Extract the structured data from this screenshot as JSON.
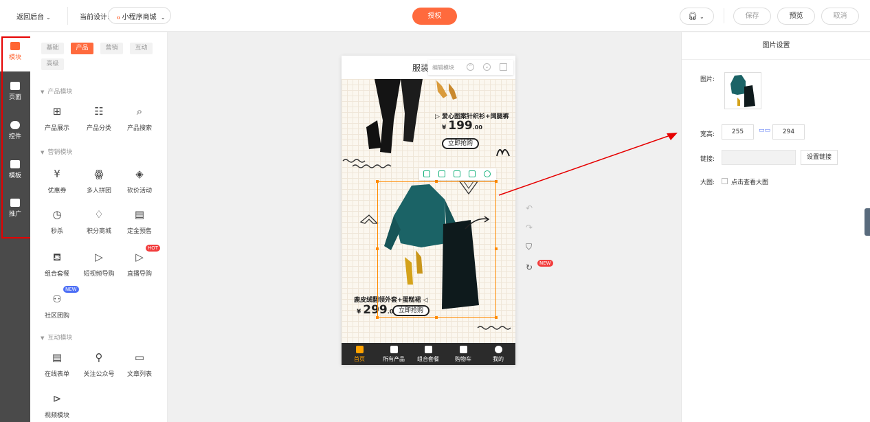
{
  "topbar": {
    "back_label": "返回后台",
    "design_label": "当前设计:",
    "design_select": "小程序商城",
    "auth_label": "授权",
    "save_label": "保存",
    "preview_label": "预览",
    "cancel_label": "取消"
  },
  "rail": {
    "items": [
      {
        "label": "模块",
        "icon": "module-icon"
      },
      {
        "label": "页面",
        "icon": "page-icon"
      },
      {
        "label": "控件",
        "icon": "control-icon"
      },
      {
        "label": "模板",
        "icon": "template-icon"
      },
      {
        "label": "推广",
        "icon": "megaphone-icon"
      }
    ]
  },
  "panel": {
    "tabs": [
      "基础",
      "产品",
      "营销",
      "互动",
      "高级"
    ],
    "active_tab": "产品",
    "sections": [
      {
        "title": "产品模块",
        "items": [
          {
            "label": "产品展示",
            "icon": "grid-icon"
          },
          {
            "label": "产品分类",
            "icon": "list-icon"
          },
          {
            "label": "产品搜索",
            "icon": "search-grid-icon"
          }
        ]
      },
      {
        "title": "营销模块",
        "items": [
          {
            "label": "优惠券",
            "icon": "coupon-icon"
          },
          {
            "label": "多人拼团",
            "icon": "group-icon"
          },
          {
            "label": "砍价活动",
            "icon": "tag-icon"
          },
          {
            "label": "秒杀",
            "icon": "timer-icon"
          },
          {
            "label": "积分商城",
            "icon": "diamond-icon"
          },
          {
            "label": "定金预售",
            "icon": "calendar-icon"
          },
          {
            "label": "组合套餐",
            "icon": "bag-icon"
          },
          {
            "label": "短视频导购",
            "icon": "video-bag-icon"
          },
          {
            "label": "直播导购",
            "icon": "live-tv-icon",
            "badge": "HOT"
          },
          {
            "label": "社区团购",
            "icon": "community-icon",
            "badge": "NEW"
          }
        ]
      },
      {
        "title": "互动模块",
        "items": [
          {
            "label": "在线表单",
            "icon": "clipboard-icon"
          },
          {
            "label": "关注公众号",
            "icon": "user-check-icon"
          },
          {
            "label": "文章列表",
            "icon": "document-icon"
          },
          {
            "label": "视频模块",
            "icon": "play-icon"
          }
        ]
      }
    ]
  },
  "phone": {
    "title": "服装",
    "edit_module": "编辑模块",
    "product1": {
      "name": "▷ 爱心图案针织衫+阔腿裤",
      "currency": "¥",
      "price": "199",
      "decimals": ".00",
      "buy": "立即抢购"
    },
    "product2": {
      "name": "鹿皮绒翻领外套+蛋糕裙 ◁",
      "currency": "¥",
      "price": "299",
      "decimals": ".00",
      "buy": "立即抢购"
    },
    "tabs": [
      "首页",
      "所有产品",
      "组合套餐",
      "购物车",
      "我的"
    ],
    "active_tab": "首页"
  },
  "side_tools": {
    "new_badge": "NEW"
  },
  "right_panel": {
    "title": "图片设置",
    "image_label": "图片:",
    "size_label": "宽高:",
    "width": "255",
    "height": "294",
    "link_label": "链接:",
    "link_value": "",
    "set_link": "设置链接",
    "big_label": "大图:",
    "big_check_label": "点击查看大图",
    "big_checked": false
  },
  "colors": {
    "accent": "#ff6a3d",
    "highlight_red": "#e60000",
    "select_orange": "#ff8a00",
    "tab_active": "#ffa200"
  }
}
